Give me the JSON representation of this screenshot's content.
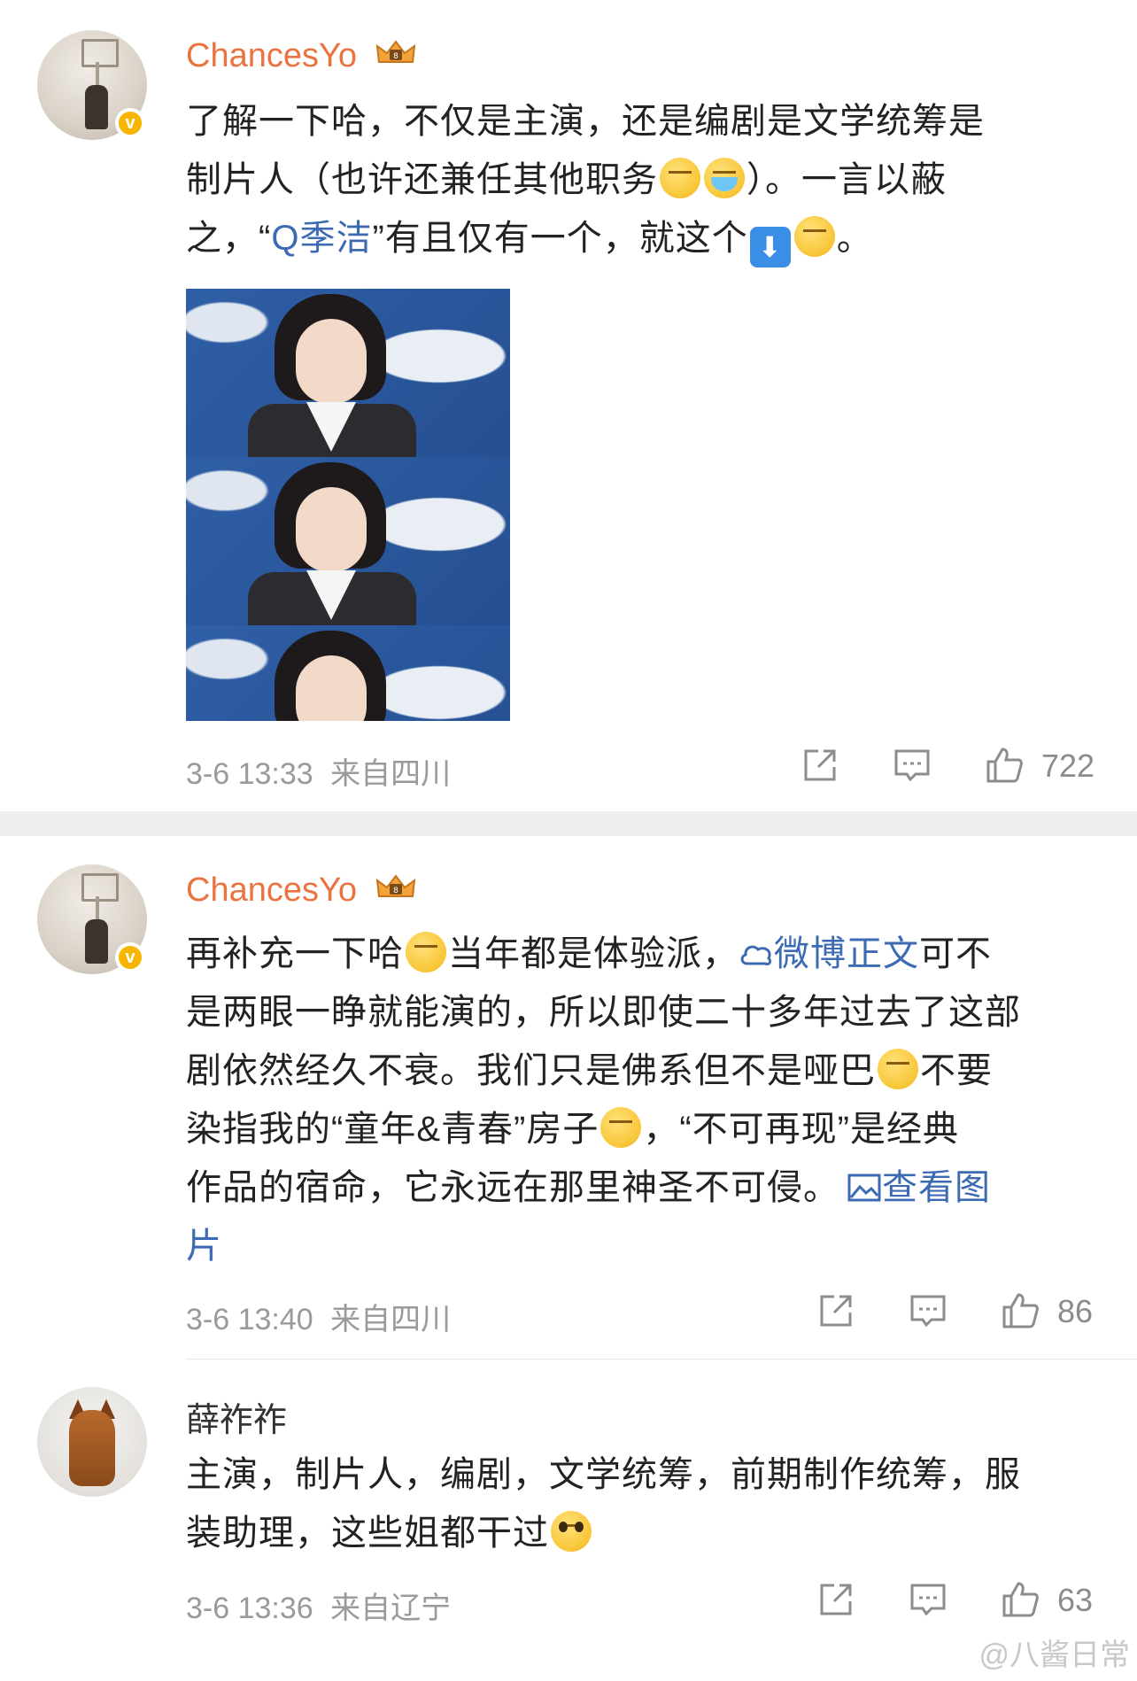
{
  "comments": [
    {
      "username": "ChancesYo",
      "content_line1": "了解一下哈，不仅是主演，还是编剧是文学统筹是",
      "content_line2a": "制片人（也许还兼任其他职务",
      "content_line2b": "）。一言以蔽",
      "content_line3a": "之，“",
      "content_link": "Q季洁",
      "content_line3b": "”有且仅有一个，就这个",
      "content_line3c": "。",
      "arrow": "⬇",
      "time": "3-6 13:33",
      "source": "来自四川",
      "likes": "722"
    },
    {
      "username": "ChancesYo",
      "p1a": "再补充一下哈",
      "p1b": "当年都是体验派，",
      "p1link": "微博正文",
      "p1c": "可不",
      "p2": "是两眼一睁就能演的，所以即使二十多年过去了这部",
      "p3a": "剧依然经久不衰。我们只是佛系但不是哑巴",
      "p3b": "不要",
      "p4a": "染指我的“童年&青春”房子",
      "p4b": "，“不可再现”是经典",
      "p5a": "作品的宿命，它永远在那里神圣不可侵。",
      "p5link": "查看图",
      "p6link": "片",
      "time": "3-6 13:40",
      "source": "来自四川",
      "likes": "86"
    },
    {
      "username": "薛祚祚",
      "line1": "主演，制片人，编剧，文学统筹，前期制作统筹，服",
      "line2": "装助理，这些姐都干过",
      "time": "3-6 13:36",
      "source": "来自辽宁",
      "likes": "63"
    }
  ],
  "watermark": "@八酱日常",
  "colors": {
    "username": "#eb7340",
    "link": "#3d6bb3",
    "meta": "#9a9a9a",
    "vbadge": "#f7b500"
  },
  "icons": [
    "repost-icon",
    "comment-icon",
    "like-icon",
    "verified-badge-icon",
    "crown-level-icon",
    "search-icon",
    "weibo-link-icon",
    "image-link-icon"
  ]
}
